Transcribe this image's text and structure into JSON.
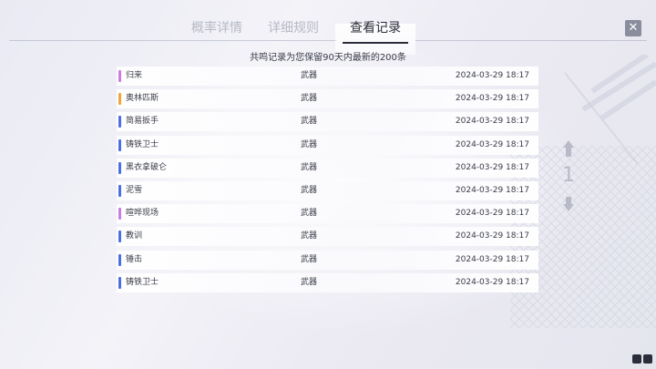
{
  "tabs": [
    {
      "label": "概率详情",
      "active": false
    },
    {
      "label": "详细规则",
      "active": false
    },
    {
      "label": "查看记录",
      "active": true
    }
  ],
  "close_label": "✕",
  "notice": "共鸣记录为您保留90天内最新的200条",
  "records": [
    {
      "name": "归来",
      "type": "武器",
      "time": "2024-03-29 18:17",
      "color": "#c97be6"
    },
    {
      "name": "奥林匹斯",
      "type": "武器",
      "time": "2024-03-29 18:17",
      "color": "#f0a43a"
    },
    {
      "name": "简易扳手",
      "type": "武器",
      "time": "2024-03-29 18:17",
      "color": "#4a6ee8"
    },
    {
      "name": "铸铁卫士",
      "type": "武器",
      "time": "2024-03-29 18:17",
      "color": "#4a6ee8"
    },
    {
      "name": "黑衣拿破仑",
      "type": "武器",
      "time": "2024-03-29 18:17",
      "color": "#4a6ee8"
    },
    {
      "name": "泥雪",
      "type": "武器",
      "time": "2024-03-29 18:17",
      "color": "#4a6ee8"
    },
    {
      "name": "喧哗现场",
      "type": "武器",
      "time": "2024-03-29 18:17",
      "color": "#c97be6"
    },
    {
      "name": "教训",
      "type": "武器",
      "time": "2024-03-29 18:17",
      "color": "#4a6ee8"
    },
    {
      "name": "锤击",
      "type": "武器",
      "time": "2024-03-29 18:17",
      "color": "#4a6ee8"
    },
    {
      "name": "铸铁卫士",
      "type": "武器",
      "time": "2024-03-29 18:17",
      "color": "#4a6ee8"
    }
  ],
  "pager": {
    "page": "1"
  },
  "icons": [
    "close-icon",
    "arrow-up-icon",
    "arrow-down-icon",
    "corner-status-icon"
  ]
}
